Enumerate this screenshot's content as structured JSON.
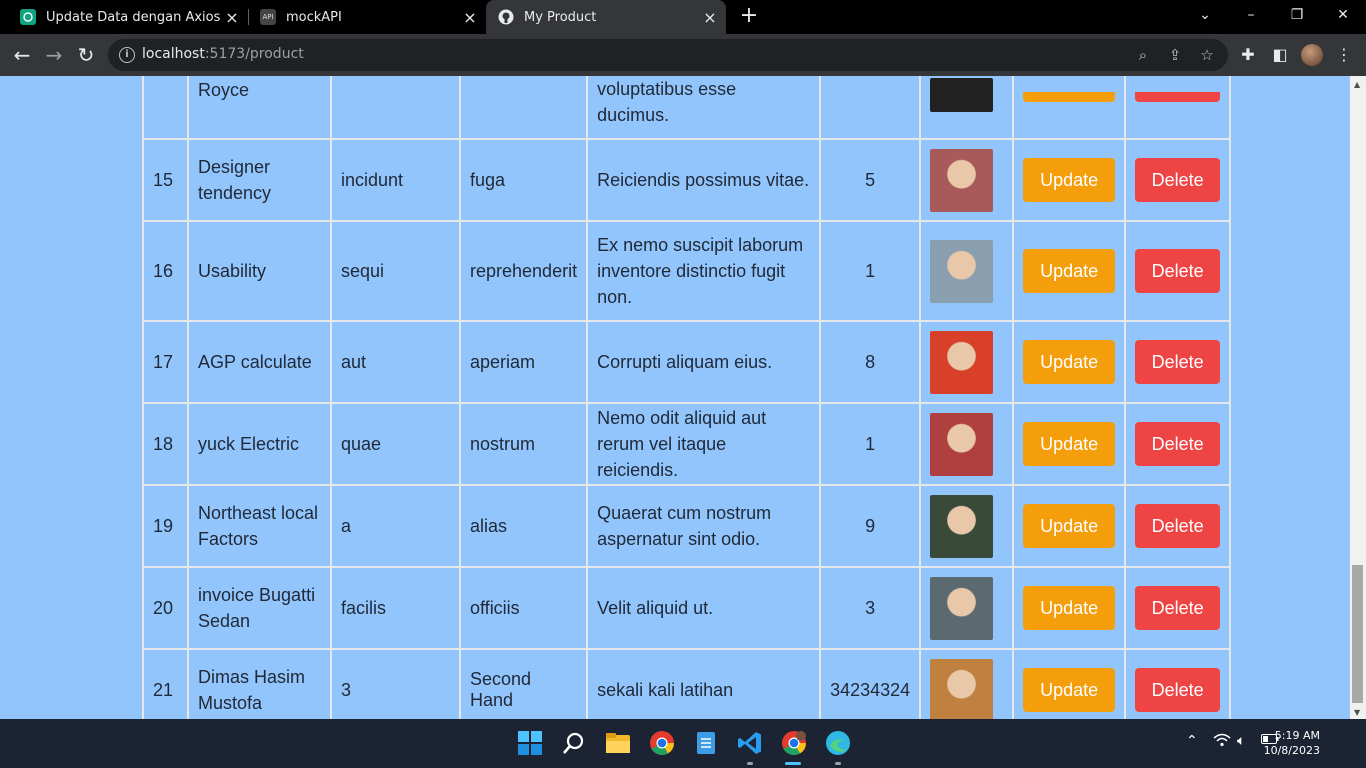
{
  "browser": {
    "tabs": [
      {
        "title": "Update Data dengan Axios",
        "favicon": "chatgpt-icon"
      },
      {
        "title": "mockAPI",
        "favicon": "mockapi-icon"
      },
      {
        "title": "My Product",
        "favicon": "github-icon"
      }
    ],
    "url_host": "localhost",
    "url_rest": ":5173/product"
  },
  "table": {
    "update_label": "Update",
    "delete_label": "Delete",
    "partial_row": {
      "name": "Royce",
      "description": "quos accusamus voluptatibus esse ducimus."
    },
    "rows": [
      {
        "id": "15",
        "name": "Designer tendency",
        "col3": "incidunt",
        "col4": "fuga",
        "description": "Reiciendis possimus vitae.",
        "qty": "5",
        "avatar_color": "#a85a5a"
      },
      {
        "id": "16",
        "name": "Usability",
        "col3": "sequi",
        "col4": "reprehenderit",
        "description": "Ex nemo suscipit laborum inventore distinctio fugit non.",
        "qty": "1",
        "avatar_color": "#8aa0b0"
      },
      {
        "id": "17",
        "name": "AGP calculate",
        "col3": "aut",
        "col4": "aperiam",
        "description": "Corrupti aliquam eius.",
        "qty": "8",
        "avatar_color": "#d8402a"
      },
      {
        "id": "18",
        "name": "yuck Electric",
        "col3": "quae",
        "col4": "nostrum",
        "description": "Nemo odit aliquid aut rerum vel itaque reiciendis.",
        "qty": "1",
        "avatar_color": "#b04040"
      },
      {
        "id": "19",
        "name": "Northeast local Factors",
        "col3": "a",
        "col4": "alias",
        "description": "Quaerat cum nostrum aspernatur sint odio.",
        "qty": "9",
        "avatar_color": "#3a4a3a"
      },
      {
        "id": "20",
        "name": "invoice Bugatti Sedan",
        "col3": "facilis",
        "col4": "officiis",
        "description": "Velit aliquid ut.",
        "qty": "3",
        "avatar_color": "#5a6a70"
      },
      {
        "id": "21",
        "name": "Dimas Hasim Mustofa",
        "col3": "3",
        "col4": "Second Hand",
        "description": "sekali kali latihan",
        "qty": "34234324",
        "avatar_color": "#c08040"
      }
    ]
  },
  "taskbar": {
    "time": "5:19 AM",
    "date": "10/8/2023"
  }
}
